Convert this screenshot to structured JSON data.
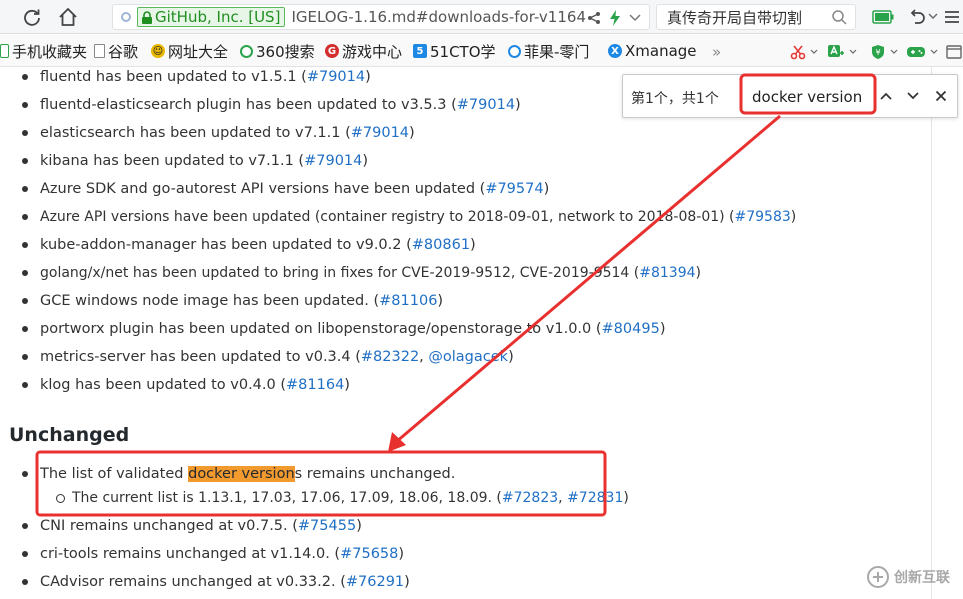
{
  "toolbar": {
    "secure_badge": "GitHub, Inc. [US]",
    "url": "IGELOG-1.16.md#downloads-for-v1164",
    "search_text": "真传奇开局自带切割"
  },
  "bookmarks": [
    {
      "label": "手机收藏夹",
      "icon": "phone-icon"
    },
    {
      "label": "谷歌",
      "icon": "page-icon"
    },
    {
      "label": "网址大全",
      "icon": "smiley-icon"
    },
    {
      "label": "360搜索",
      "icon": "360-search-icon"
    },
    {
      "label": "游戏中心",
      "icon": "game-center-icon"
    },
    {
      "label": "51CTO学",
      "icon": "51cto-icon"
    },
    {
      "label": "菲果-零门",
      "icon": "fruit-icon"
    },
    {
      "label": "Xmanage",
      "icon": "xmanage-icon"
    }
  ],
  "bookmarks_more": "»",
  "find": {
    "count": "第1个，共1个",
    "query": "docker version"
  },
  "content": {
    "items": [
      {
        "text": "fluentd has been updated to v1.5.1 (",
        "link": "#79014",
        "end": ")"
      },
      {
        "text": "fluentd-elasticsearch plugin has been updated to v3.5.3 (",
        "link": "#79014",
        "end": ")"
      },
      {
        "text": "elasticsearch has been updated to v7.1.1 (",
        "link": "#79014",
        "end": ")"
      },
      {
        "text": "kibana has been updated to v7.1.1 (",
        "link": "#79014",
        "end": ")"
      },
      {
        "text": "Azure SDK and go-autorest API versions have been updated (",
        "link": "#79574",
        "end": ")"
      },
      {
        "text": "Azure API versions have been updated (container registry to 2018-09-01, network to 2018-08-01) (",
        "link": "#79583",
        "end": ")"
      },
      {
        "text": "kube-addon-manager has been updated to v9.0.2 (",
        "link": "#80861",
        "end": ")"
      },
      {
        "text": "golang/x/net has been updated to bring in fixes for CVE-2019-9512, CVE-2019-9514 (",
        "link": "#81394",
        "end": ")"
      },
      {
        "text": "GCE windows node image has been updated. (",
        "link": "#81106",
        "end": ")"
      },
      {
        "text": "portworx plugin has been updated on libopenstorage/openstorage to v1.0.0 (",
        "link": "#80495",
        "end": ")"
      },
      {
        "text": "metrics-server has been updated to v0.3.4 (",
        "link": "#82322",
        "mid": ", ",
        "link2": "@olagacek",
        "end": ")"
      },
      {
        "text": "klog has been updated to v0.4.0 (",
        "link": "#81164",
        "end": ")"
      }
    ],
    "section_title": "Unchanged",
    "docker_item": {
      "before": "The list of validated ",
      "highlight": "docker version",
      "after": "s remains unchanged."
    },
    "docker_sub": {
      "text": "The current list is 1.13.1, 17.03, 17.06, 17.09, 18.06, 18.09. (",
      "link": "#72823",
      "mid": ", ",
      "link2": "#72831",
      "end": ")"
    },
    "unchanged_items": [
      {
        "text": "CNI remains unchanged at v0.7.5. (",
        "link": "#75455",
        "end": ")"
      },
      {
        "text": "cri-tools remains unchanged at v1.14.0. (",
        "link": "#75658",
        "end": ")"
      },
      {
        "text": "CAdvisor remains unchanged at v0.33.2. (",
        "link": "#76291",
        "end": ")"
      }
    ]
  },
  "annotation": {
    "color": "#e8312f"
  },
  "colors": {
    "link": "#1f6fc5",
    "highlight": "#f29a2e",
    "secure": "#1f8f1f"
  }
}
